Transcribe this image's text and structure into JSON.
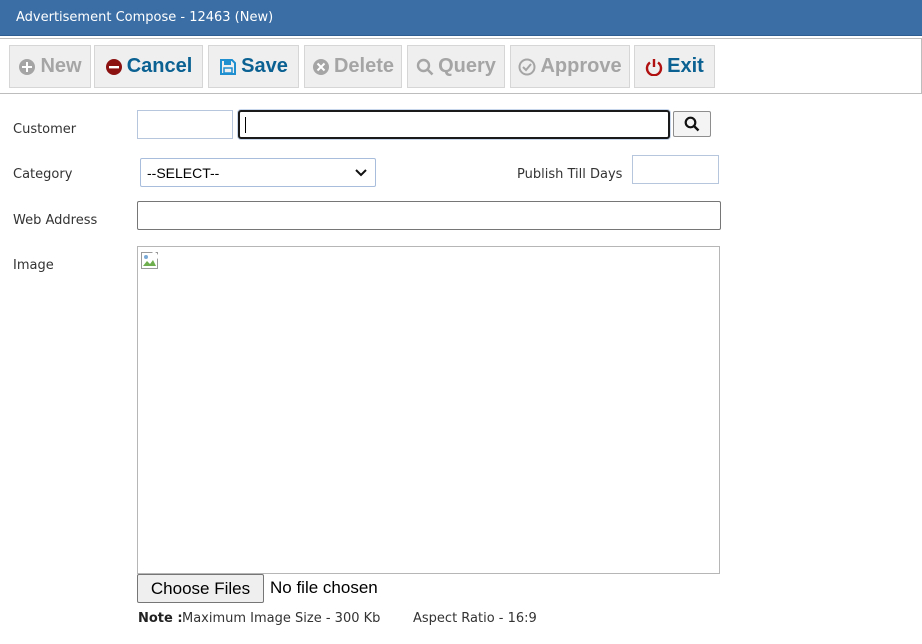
{
  "window": {
    "title": "Advertisement Compose - 12463 (New)"
  },
  "toolbar": {
    "new_label": "New",
    "cancel_label": "Cancel",
    "save_label": "Save",
    "delete_label": "Delete",
    "query_label": "Query",
    "approve_label": "Approve",
    "exit_label": "Exit"
  },
  "form": {
    "customer_label": "Customer",
    "customer_code_value": "",
    "customer_name_value": "",
    "category_label": "Category",
    "category_selected": "--SELECT--",
    "publish_label": "Publish Till Days",
    "publish_value": "",
    "web_label": "Web Address",
    "web_value": "",
    "image_label": "Image",
    "choose_files_label": "Choose Files",
    "no_file_text": "No file chosen",
    "note_label": "Note :",
    "note_text": "Maximum Image Size - 300 Kb",
    "aspect_text": "Aspect Ratio - 16:9"
  },
  "colors": {
    "title_bg": "#3a6ea5",
    "active_button_text": "#0a6192",
    "disabled_button_text": "#a5a5a5",
    "cancel_icon": "#8b1111",
    "exit_icon": "#b01010"
  },
  "icons": {
    "new": "plus-circle-icon",
    "cancel": "minus-circle-icon",
    "save": "floppy-disk-icon",
    "delete": "x-circle-icon",
    "query": "search-icon",
    "approve": "check-circle-icon",
    "exit": "power-icon",
    "lookup": "search-icon",
    "select": "chevron-down-icon",
    "image": "broken-image-icon"
  }
}
